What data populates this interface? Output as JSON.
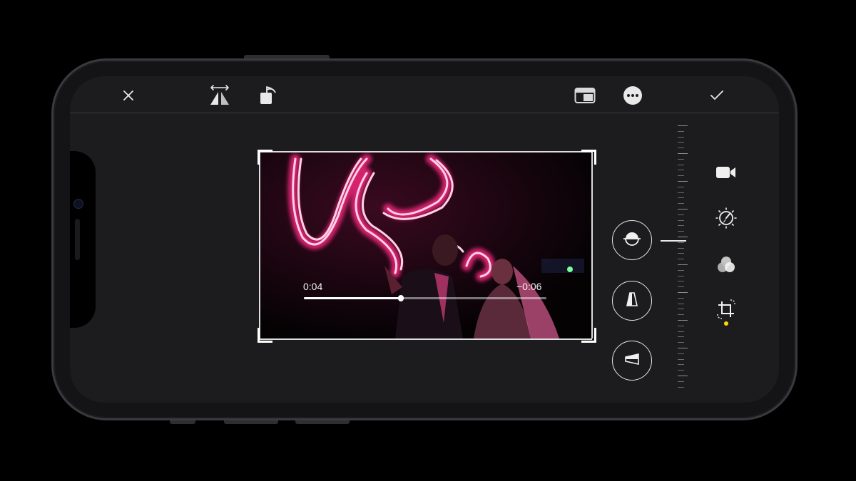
{
  "toolbar": {
    "cancel_icon": "close-icon",
    "flip_icon": "flip-horizontal-icon",
    "rotate_icon": "rotate-icon",
    "aspect_icon": "aspect-ratio-icon",
    "more_icon": "more-icon",
    "done_icon": "checkmark-icon"
  },
  "video": {
    "time_elapsed": "0:04",
    "time_remaining": "−0:06",
    "progress": 0.4
  },
  "straighten_tools": [
    {
      "name": "straighten-icon"
    },
    {
      "name": "vertical-perspective-icon"
    },
    {
      "name": "horizontal-perspective-icon"
    }
  ],
  "edit_modes": [
    {
      "name": "video-camera-icon"
    },
    {
      "name": "adjust-dial-icon"
    },
    {
      "name": "filters-icon"
    },
    {
      "name": "crop-rotate-icon",
      "selected": true
    }
  ],
  "colors": {
    "accent_dot": "#ffd60a",
    "neon": "#ff2a84",
    "background": "#1c1c1e"
  }
}
